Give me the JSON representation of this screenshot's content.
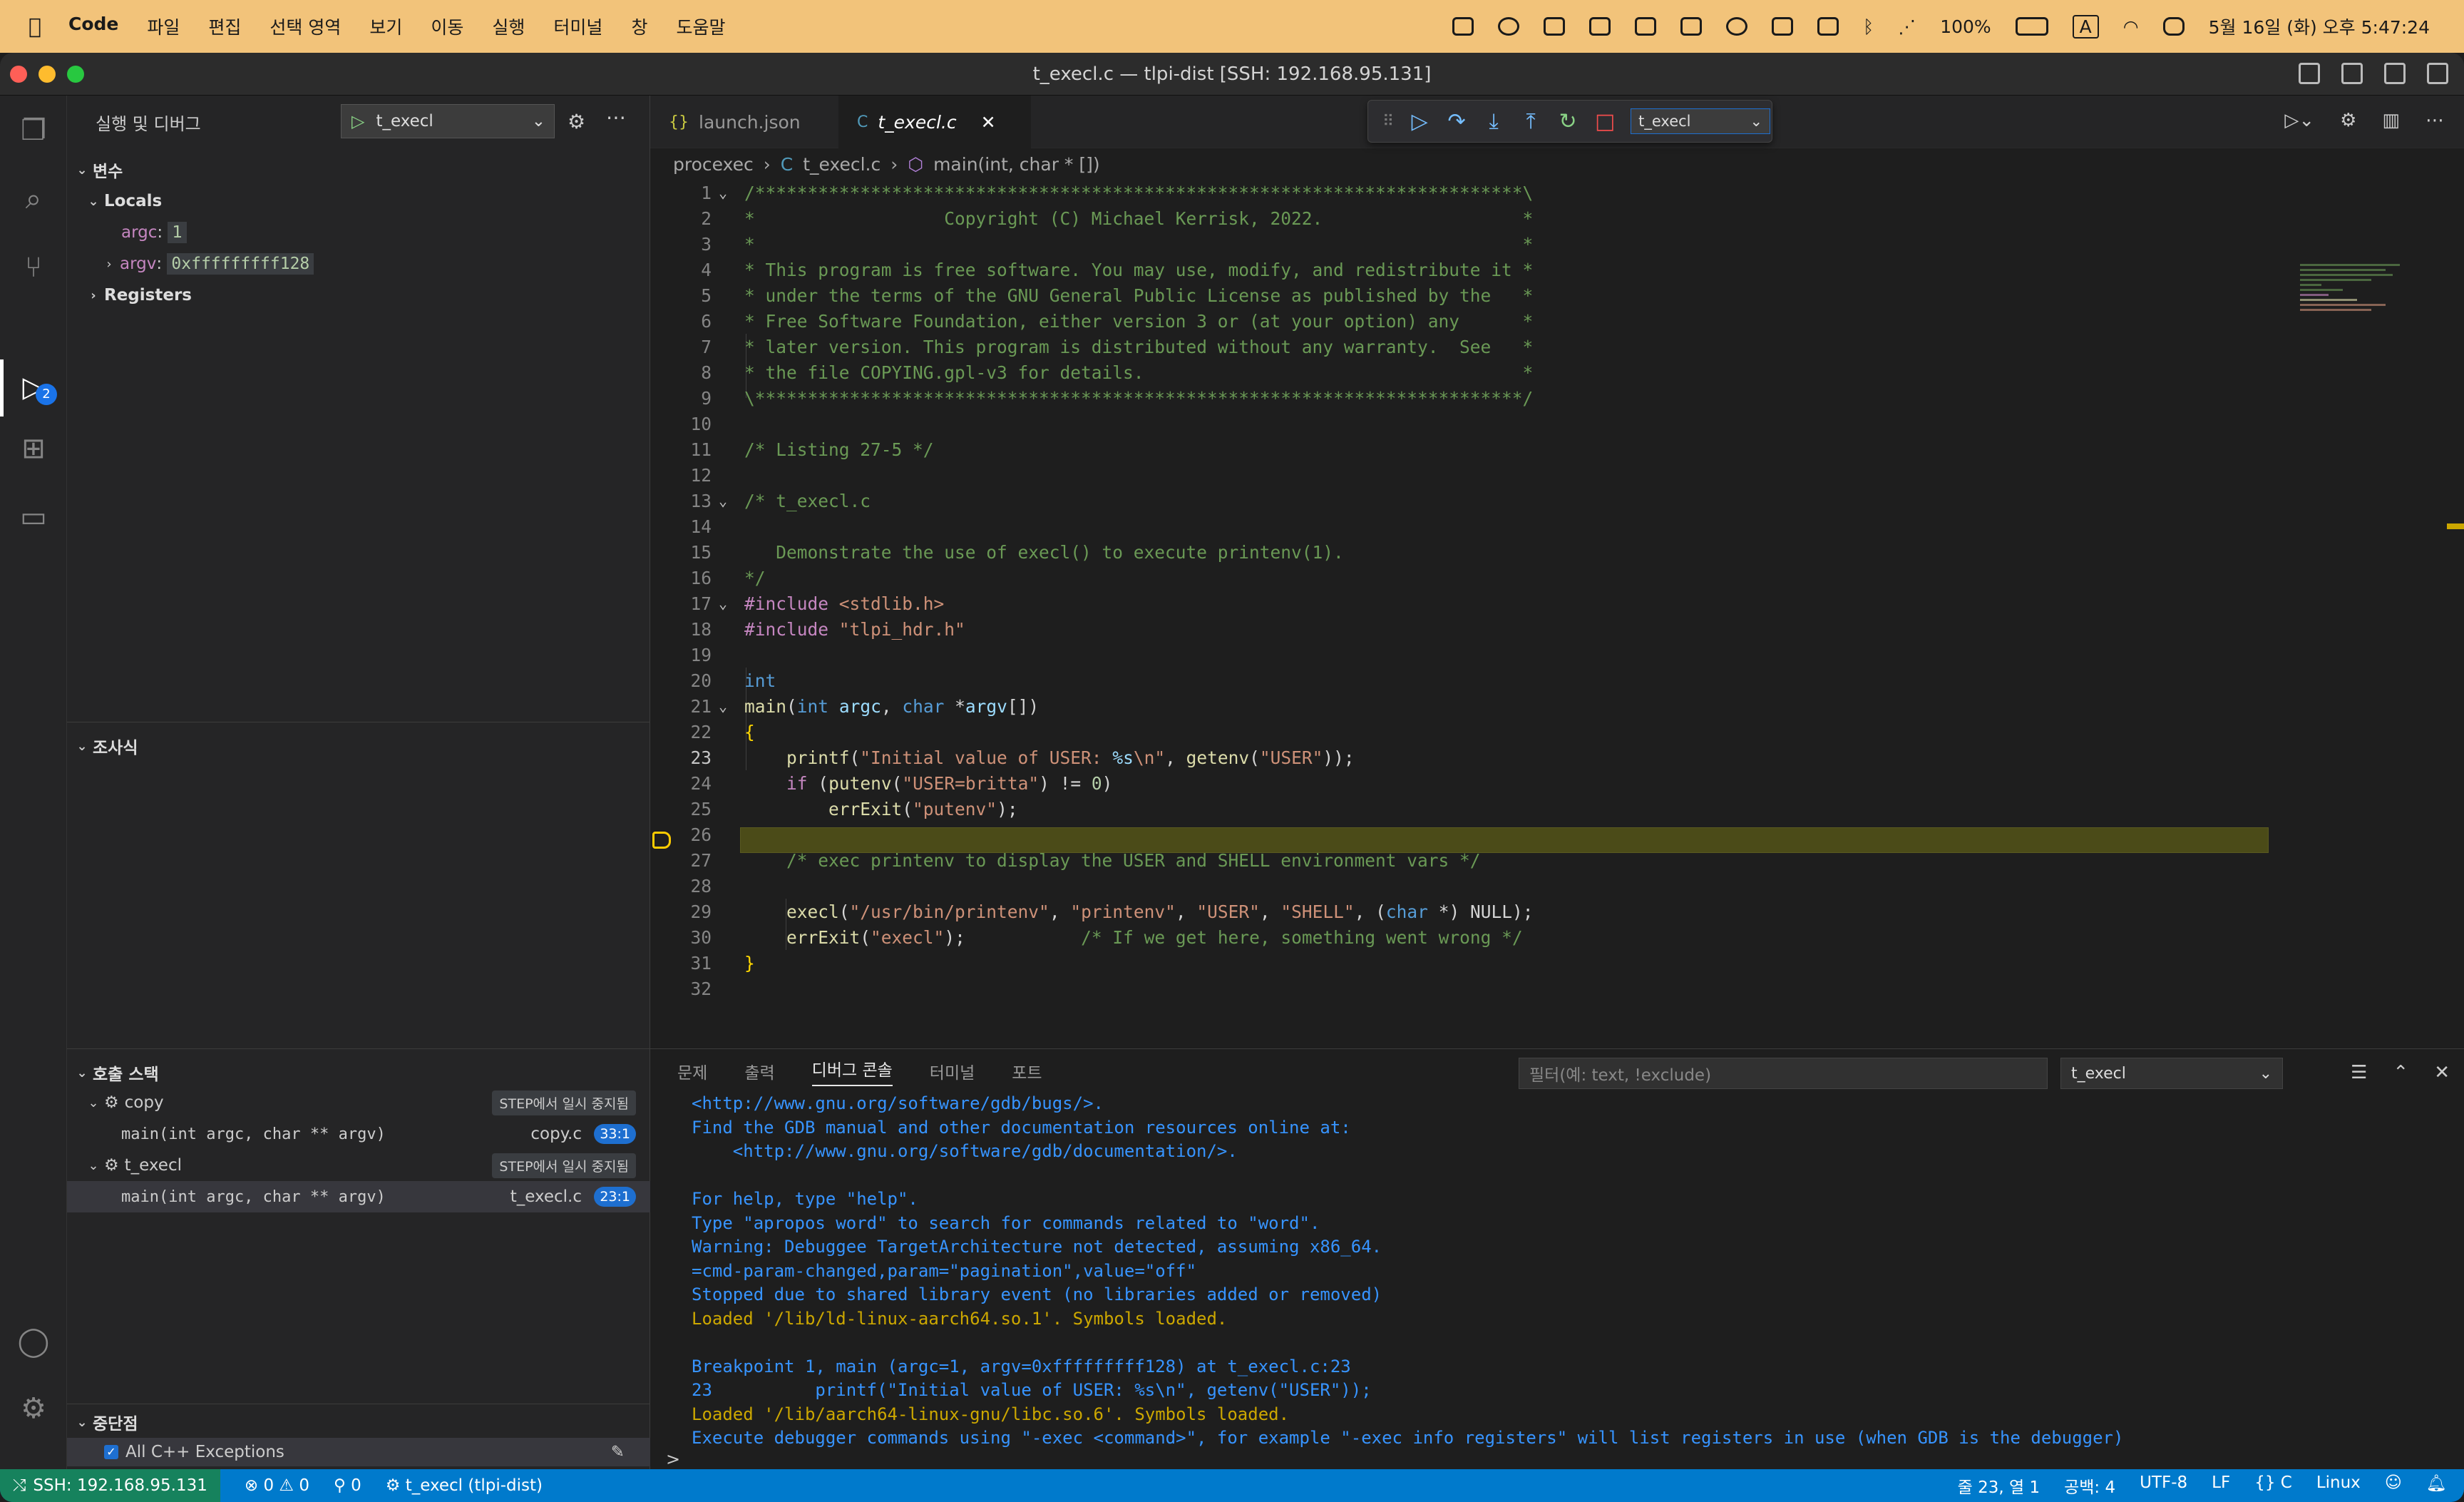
{
  "menubar": {
    "apple_icon": "",
    "app": "Code",
    "items": [
      "파일",
      "편집",
      "선택 영역",
      "보기",
      "이동",
      "실행",
      "터미널",
      "창",
      "도움말"
    ],
    "battery": "100%",
    "input_indicator": "A",
    "clock": "5월 16일 (화) 오후 5:47:24"
  },
  "window": {
    "title": "t_execl.c — tlpi-dist [SSH: 192.168.95.131]"
  },
  "sidebar": {
    "title": "실행 및 디버그",
    "config": "t_execl",
    "variables_title": "변수",
    "locals_title": "Locals",
    "locals": [
      {
        "name": "argc",
        "value": "1"
      },
      {
        "name": "argv",
        "value": "0xfffffffff128"
      }
    ],
    "registers_title": "Registers",
    "watch_title": "조사식",
    "callstack_title": "호출 스택",
    "callstack": [
      {
        "thread": "copy",
        "status": "STEP에서 일시 중지됨",
        "frame": "main(int argc, char ** argv)",
        "file": "copy.c",
        "line": "33:1"
      },
      {
        "thread": "t_execl",
        "status": "STEP에서 일시 중지됨",
        "frame": "main(int argc, char ** argv)",
        "file": "t_execl.c",
        "line": "23:1"
      }
    ],
    "breakpoints_title": "중단점",
    "breakpoint_item": "All C++ Exceptions",
    "badge": "2"
  },
  "editor": {
    "tabs": [
      {
        "label": "launch.json",
        "icon": "{}"
      },
      {
        "label": "t_execl.c",
        "icon": "C"
      }
    ],
    "debug_target": "t_execl",
    "breadcrumb": [
      "procexec",
      "t_execl.c",
      "main(int, char * [])"
    ],
    "current_line": 23
  },
  "panel": {
    "tabs": [
      "문제",
      "출력",
      "디버그 콘솔",
      "터미널",
      "포트"
    ],
    "filter_placeholder": "필터(예: text, !exclude)",
    "session": "t_execl",
    "console": [
      "<http://www.gnu.org/software/gdb/bugs/>.",
      "Find the GDB manual and other documentation resources online at:",
      "    <http://www.gnu.org/software/gdb/documentation/>.",
      "",
      "For help, type \"help\".",
      "Type \"apropos word\" to search for commands related to \"word\".",
      "Warning: Debuggee TargetArchitecture not detected, assuming x86_64.",
      "=cmd-param-changed,param=\"pagination\",value=\"off\"",
      "Stopped due to shared library event (no libraries added or removed)",
      "Loaded '/lib/ld-linux-aarch64.so.1'. Symbols loaded.",
      "",
      "Breakpoint 1, main (argc=1, argv=0xfffffffff128) at t_execl.c:23",
      "23          printf(\"Initial value of USER: %s\\n\", getenv(\"USER\"));",
      "Loaded '/lib/aarch64-linux-gnu/libc.so.6'. Symbols loaded.",
      "Execute debugger commands using \"-exec <command>\", for example \"-exec info registers\" will list registers in use (when GDB is the debugger)"
    ],
    "prompt": ">"
  },
  "statusbar": {
    "remote": "SSH: 192.168.95.131",
    "problems": "⊗ 0 ⚠ 0",
    "ports": "0",
    "debug": "t_execl (tlpi-dist)",
    "position": "줄 23, 열 1",
    "spaces": "공백: 4",
    "encoding": "UTF-8",
    "eol": "LF",
    "language": "C",
    "os": "Linux"
  }
}
